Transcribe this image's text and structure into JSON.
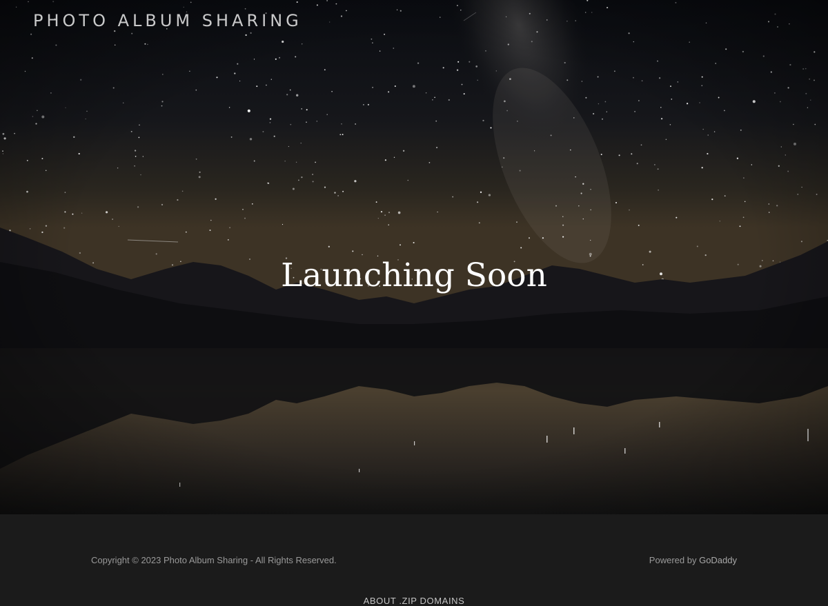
{
  "header": {
    "site_title": "PHOTO ALBUM SHARING"
  },
  "hero": {
    "headline": "Launching Soon",
    "background_description_icon": "starry-lake-mountains"
  },
  "footer": {
    "copyright": "Copyright © 2023 Photo Album Sharing - All Rights Reserved.",
    "powered_prefix": "Powered by",
    "powered_link": "GoDaddy",
    "about_link": "ABOUT .ZIP DOMAINS"
  },
  "colors": {
    "sky_top": "#0b0d12",
    "sky_horizon": "#3a3025",
    "footer_bg": "#1b1b1b",
    "headline": "#ffffff"
  }
}
